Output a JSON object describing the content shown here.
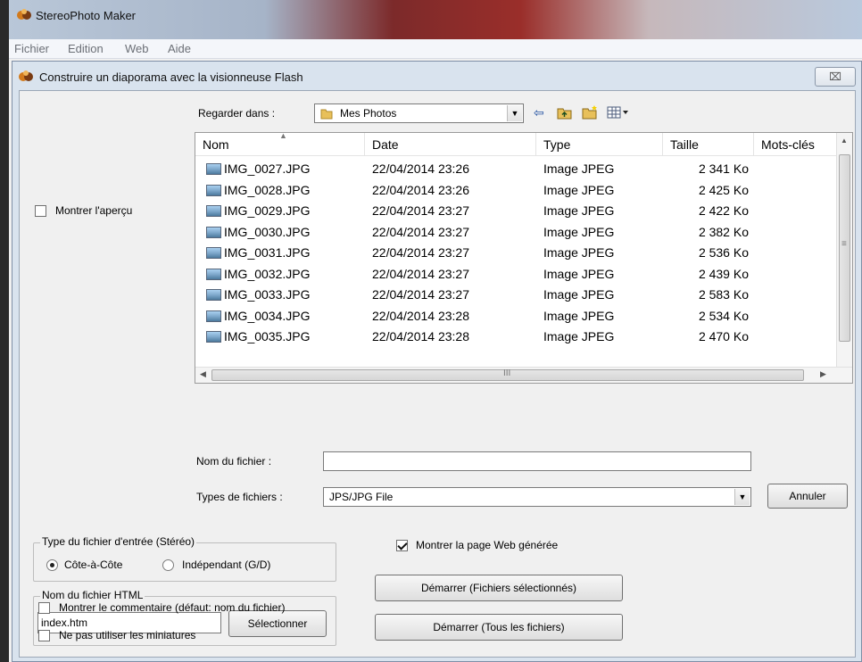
{
  "app": {
    "title": "StereoPhoto Maker",
    "menu": [
      "Fichier",
      "Edition",
      "Web",
      "Aide"
    ]
  },
  "dialog": {
    "title": "Construire un diaporama avec la visionneuse Flash",
    "close_glyph": "⌧"
  },
  "browser": {
    "look_in_label": "Regarder dans :",
    "look_in_value": "Mes Photos",
    "show_preview_label": "Montrer l'aperçu",
    "columns": [
      "Nom",
      "Date",
      "Type",
      "Taille",
      "Mots-clés"
    ],
    "files": [
      {
        "name": "IMG_0027.JPG",
        "date": "22/04/2014 23:26",
        "type": "Image JPEG",
        "size": "2 341 Ko"
      },
      {
        "name": "IMG_0028.JPG",
        "date": "22/04/2014 23:26",
        "type": "Image JPEG",
        "size": "2 425 Ko"
      },
      {
        "name": "IMG_0029.JPG",
        "date": "22/04/2014 23:27",
        "type": "Image JPEG",
        "size": "2 422 Ko"
      },
      {
        "name": "IMG_0030.JPG",
        "date": "22/04/2014 23:27",
        "type": "Image JPEG",
        "size": "2 382 Ko"
      },
      {
        "name": "IMG_0031.JPG",
        "date": "22/04/2014 23:27",
        "type": "Image JPEG",
        "size": "2 536 Ko"
      },
      {
        "name": "IMG_0032.JPG",
        "date": "22/04/2014 23:27",
        "type": "Image JPEG",
        "size": "2 439 Ko"
      },
      {
        "name": "IMG_0033.JPG",
        "date": "22/04/2014 23:27",
        "type": "Image JPEG",
        "size": "2 583 Ko"
      },
      {
        "name": "IMG_0034.JPG",
        "date": "22/04/2014 23:28",
        "type": "Image JPEG",
        "size": "2 534 Ko"
      },
      {
        "name": "IMG_0035.JPG",
        "date": "22/04/2014 23:28",
        "type": "Image JPEG",
        "size": "2 470 Ko"
      }
    ],
    "scroll_grip": "≡",
    "hscroll_grip": "III",
    "file_name_label": "Nom du fichier :",
    "file_name_value": "",
    "file_types_label": "Types de fichiers :",
    "file_types_value": "JPS/JPG File",
    "cancel_label": "Annuler"
  },
  "input_type": {
    "caption": "Type du fichier d'entrée (Stéréo)",
    "side_by_side": "Côte-à-Côte",
    "independent": "Indépendant (G/D)",
    "selected": "side_by_side"
  },
  "html_file": {
    "caption": "Nom du fichier HTML",
    "value": "index.htm",
    "select_label": "Sélectionner"
  },
  "options": {
    "show_web_page": "Montrer la page Web générée",
    "show_web_page_checked": true,
    "show_comment": "Montrer le commentaire (défaut: nom du fichier)",
    "show_comment_checked": false,
    "no_thumbnails": "Ne pas utiliser les miniatures",
    "no_thumbnails_checked": false,
    "show_preview_checked": false
  },
  "actions": {
    "start_selected": "Démarrer (Fichiers sélectionnés)",
    "start_all": "Démarrer (Tous les fichiers)"
  }
}
